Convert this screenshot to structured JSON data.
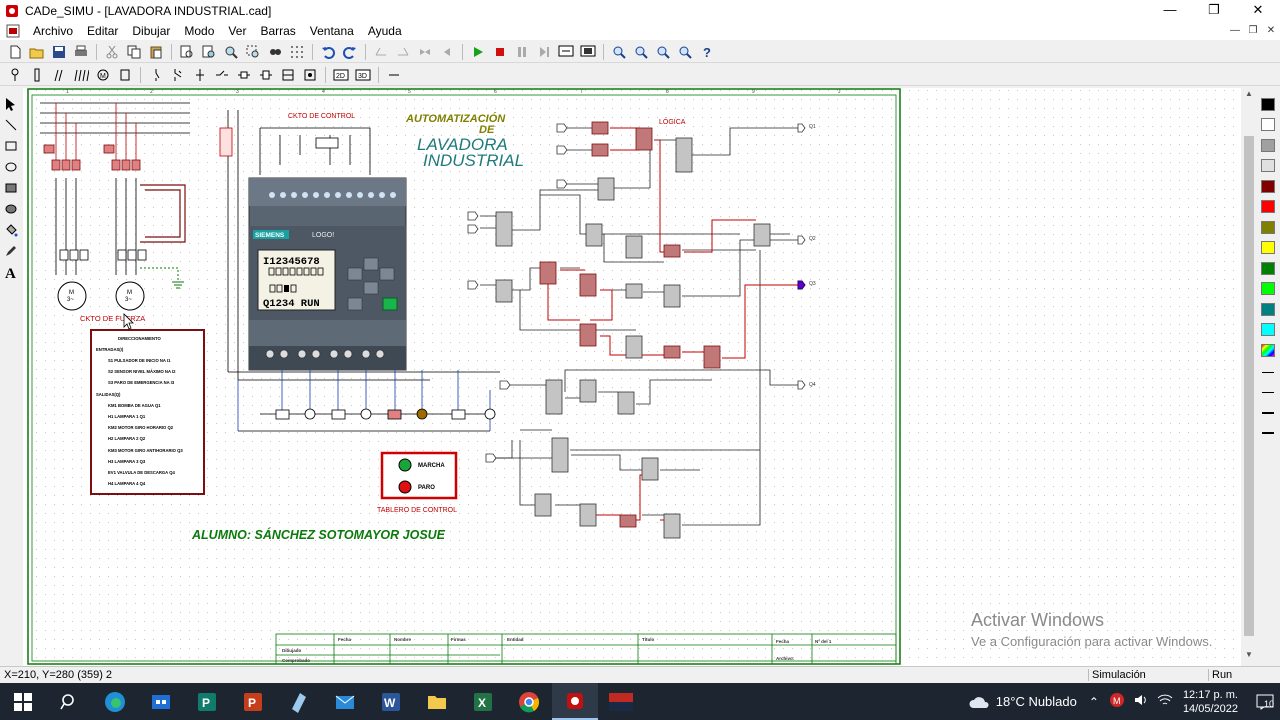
{
  "window": {
    "title": "CADe_SIMU - [LAVADORA INDUSTRIAL.cad]"
  },
  "menu": [
    "Archivo",
    "Editar",
    "Dibujar",
    "Modo",
    "Ver",
    "Barras",
    "Ventana",
    "Ayuda"
  ],
  "drawing": {
    "title_line1": "AUTOMATIZACIÓN",
    "title_line2": "DE",
    "title_big1": "LAVADORA",
    "title_big2": "INDUSTRIAL",
    "ckto_control": "CKTO DE CONTROL",
    "ckto_fuerza": "CKTO DE FUERZA",
    "logica": "LÓGICA",
    "siemens": "SIEMENS",
    "logo": "LOGO!",
    "lcd_line1": "I12345678",
    "lcd_line2": "Q1234 RUN",
    "panel_label": "TABLERO DE CONTROL",
    "btn_marcha": "MARCHA",
    "btn_paro": "PARO",
    "student": "ALUMNO: SÁNCHEZ SOTOMAYOR    JOSUE",
    "legend_title": "DIRECCIONAMIENTO",
    "legend_entradas": "ENTRADAS(I)",
    "legend_inputs": [
      "S1 PULSADOR DE INICIO NA I1",
      "S2 SENSOR NIVEL MÁXIMO NA I2",
      "S3 PARO DE EMERGENCIA NA I3"
    ],
    "legend_salidas": "SALIDAS(Q)",
    "legend_outputs": [
      "KM1 BOMBA DE AGUA Q1",
      "H1 LAMPARA 1 Q1",
      "KM2 MOTOR GIRO HORARIO Q2",
      "H2 LAMPARA 2 Q2",
      "KM3 MOTOR GIRO ANTIHORARIO Q3",
      "H3 LAMPARA 3 Q3",
      "EV1 VALVULA DE DESCARGA Q4",
      "H4 LAMPARA 4 Q4"
    ],
    "titleblock_headers": [
      "Fecha",
      "Nombre",
      "Firmas",
      "Entidad",
      "Título",
      "Fecha",
      "Nº del 1"
    ],
    "titleblock_rows": [
      "Dibujado",
      "Comprobado"
    ],
    "titleblock_archivo": "Archivo:",
    "q_labels": [
      "Q1",
      "Q2",
      "Q3",
      "Q4"
    ]
  },
  "watermark": {
    "line1": "Activar Windows",
    "line2": "Ve a Configuración para activar Windows."
  },
  "status": {
    "coords": "X=210, Y=280 (359) 2",
    "mode": "Simulación",
    "state": "Run"
  },
  "taskbar": {
    "weather": "18°C  Nublado",
    "time": "12:17 p. m.",
    "date": "14/05/2022",
    "notifications": "10"
  },
  "colors": {
    "dark_red": "#7b0e0e",
    "red": "#c00000",
    "teal": "#1f7a7a",
    "title_olive": "#808000",
    "green_text": "#0a7a0a",
    "purple": "#5a00c8"
  },
  "palette_colors": [
    "#000000",
    "#ffffff",
    "#a0a0a0",
    "#e0e0e0",
    "#800000",
    "#ff0000",
    "#808000",
    "#ffff00",
    "#008000",
    "#00ff00",
    "#008080",
    "#00ffff"
  ]
}
